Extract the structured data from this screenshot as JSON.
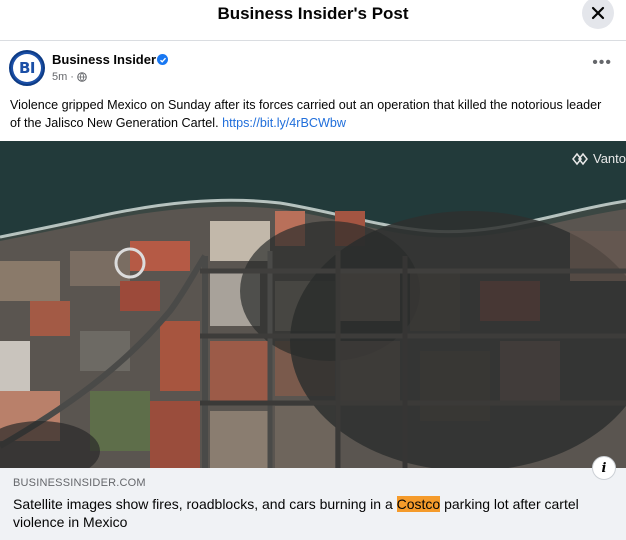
{
  "header": {
    "title": "Business Insider's Post"
  },
  "post": {
    "author": "Business Insider",
    "avatar_text": "BI",
    "time": "5m",
    "dot": "·",
    "more": "•••",
    "text_main": "Violence gripped Mexico on Sunday after its forces carried out an operation that killed the notorious leader of the Jalisco New Generation Cartel. ",
    "link": "https://bit.ly/4rBCWbw"
  },
  "image": {
    "watermark": "Vanto"
  },
  "link_preview": {
    "domain": "BUSINESSINSIDER.COM",
    "headline_before": "Satellite images show fires, roadblocks, and cars burning in a ",
    "headline_highlight": "Costco",
    "headline_after": " parking lot after cartel violence in Mexico",
    "info": "i"
  },
  "icons": {
    "close": "close-icon",
    "verified": "verified-badge-icon",
    "globe": "globe-icon",
    "info": "info-icon",
    "watermark_logo": "vantor-logo-icon"
  },
  "colors": {
    "link": "#216fdb",
    "verified": "#1877f2",
    "highlight": "#f59b2b",
    "brand": "#1b4fa6"
  }
}
